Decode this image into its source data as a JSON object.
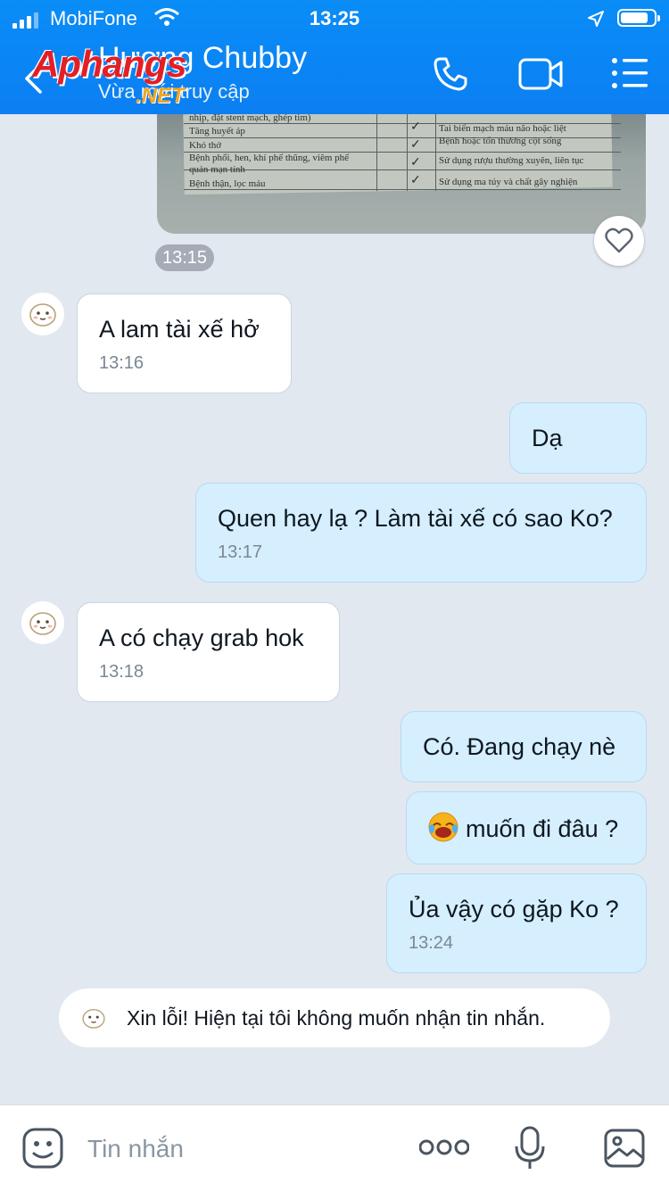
{
  "status_bar": {
    "carrier": "MobiFone",
    "time": "13:25",
    "battery_level": 0.85
  },
  "header": {
    "contact_name": "Hương Chubby",
    "contact_status": "Vừa mới truy cập"
  },
  "watermark": {
    "brand": "Aphangs",
    "suffix": ".NET"
  },
  "shared_photo": {
    "rows_left": [
      "nhịp, đặt stent mạch, ghép tim)",
      "Tăng huyết áp",
      "Khó thở",
      "Bệnh phổi, hen, khí phế thũng, viêm phế",
      "quản mạn tính",
      "Bệnh thận, lọc máu"
    ],
    "rows_right": [
      "Tai biến mạch máu não hoặc liệt",
      "Bệnh hoặc tổn thương cột sống",
      "Sử dụng rượu thường xuyên, liên tục",
      "Sử dụng ma túy và chất gây nghiện"
    ],
    "time": "13:15"
  },
  "messages": [
    {
      "dir": "in",
      "text": "A lam tài xế hở",
      "time": "13:16"
    },
    {
      "dir": "out",
      "text": "Dạ",
      "time": ""
    },
    {
      "dir": "out",
      "text": "Quen hay lạ ? Làm tài xế có sao Ko?",
      "time": "13:17"
    },
    {
      "dir": "in",
      "text": "A có chạy grab hok",
      "time": "13:18"
    },
    {
      "dir": "out",
      "text": "Có. Đang chạy nè",
      "time": ""
    },
    {
      "dir": "out",
      "text": "muốn đi đâu ?",
      "emoji": "laughing-crying-emoji",
      "time": ""
    },
    {
      "dir": "out",
      "text": "Ủa vậy có gặp Ko ?",
      "time": "13:24"
    }
  ],
  "auto_reply": "Xin lỗi! Hiện tại tôi không muốn nhận tin nhắn.",
  "input": {
    "placeholder": "Tin nhắn"
  },
  "colors": {
    "header": "#0b84f5",
    "outgoing_bubble": "#d5efff",
    "incoming_bubble": "#ffffff",
    "chat_background": "#e2e8f0"
  }
}
